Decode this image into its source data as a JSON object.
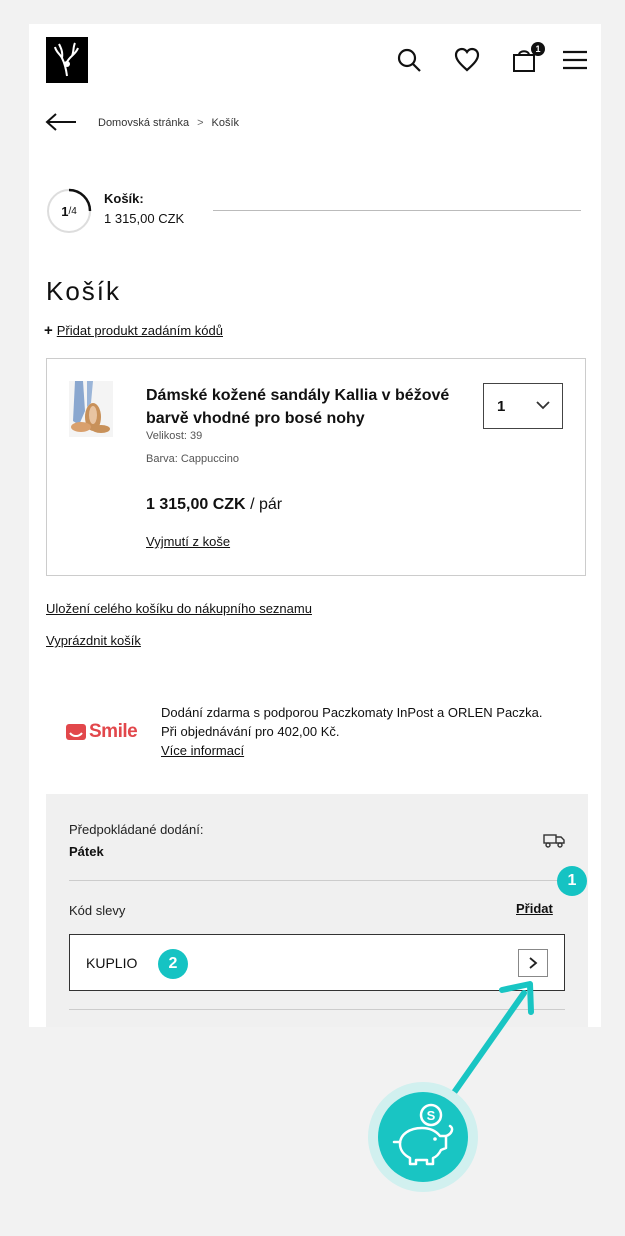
{
  "header": {
    "logo": "brand-logo",
    "icons": [
      "search-icon",
      "heart-icon",
      "bag-icon",
      "menu-icon"
    ],
    "cart_count": "1"
  },
  "breadcrumb": {
    "home": "Domovská stránka",
    "separator": ">",
    "current": "Košík"
  },
  "step": {
    "current": "1",
    "total": "/4",
    "title": "Košík:",
    "amount": "1 315,00 CZK",
    "progress_fraction": 0.25
  },
  "page_title": "Košík",
  "add_by_code": {
    "plus": "+",
    "label": "Přidat produkt zadáním kódů"
  },
  "cart_item": {
    "name": "Dámské kožené sandály Kallia v béžové barvě vhodné pro bosé nohy",
    "size": "Velikost: 39",
    "color": "Barva: Cappuccino",
    "price": "1 315,00 CZK",
    "unit": "/ pár",
    "remove": "Vyjmutí z koše",
    "quantity": "1"
  },
  "links": {
    "save_list": "Uložení celého košíku do nákupního seznamu",
    "empty_cart": "Vyprázdnit košík"
  },
  "promo": {
    "brand": "Smile",
    "text": "Dodání zdarma s podporou Paczkomaty InPost a ORLEN Paczka. Při objednávání pro 402,00 Kč.",
    "more": "Více informací"
  },
  "summary": {
    "est_label": "Předpokládané dodání:",
    "est_day": "Pátek",
    "discount_label": "Kód slevy",
    "discount_add": "Přidat",
    "discount_code": "KUPLIO"
  },
  "badges": [
    "1",
    "2"
  ],
  "colors": {
    "accent": "#15c3c3",
    "smile_red": "#e2474b",
    "summary_bg": "#f0f0f0"
  }
}
